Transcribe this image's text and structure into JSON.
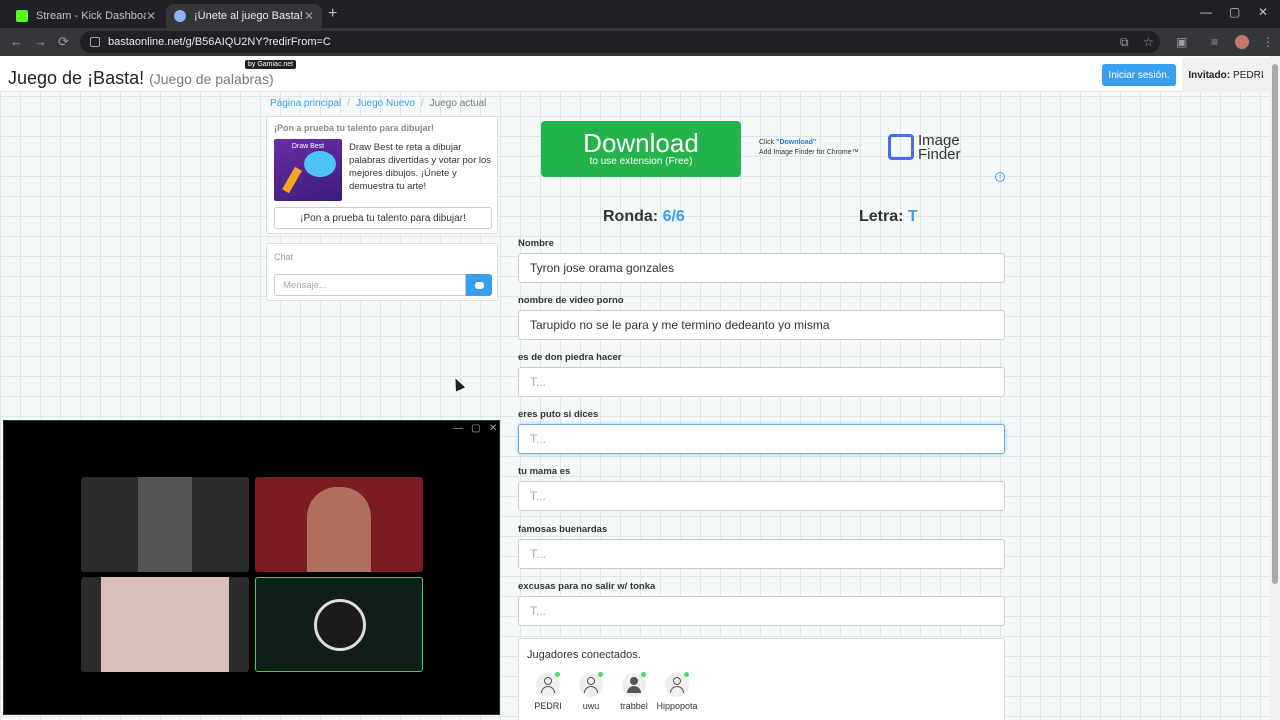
{
  "browser": {
    "tabs": [
      {
        "title": "Stream - Kick Dashboard",
        "close": "✕"
      },
      {
        "title": "¡Únete al juego Basta!",
        "close": "✕"
      }
    ],
    "new_tab": "+",
    "window_controls": [
      "—",
      "▢",
      "✕"
    ],
    "nav": [
      "←",
      "→",
      "⟳"
    ],
    "url": "bastaonline.net/g/B56AIQU2NY?redirFrom=C",
    "toolbar_icons": [
      "translate-icon",
      "star-icon",
      "screen-icon",
      "media-icon",
      "profile-icon",
      "menu-icon"
    ],
    "toolbar_glyphs": [
      "⧉",
      "☆",
      "▣",
      "≡",
      "⋮"
    ]
  },
  "header": {
    "title": "Juego de ¡Basta!",
    "subtitle": "(Juego de palabras)",
    "badge": "by Gamiac.net",
    "login": "Iniciar sesión.",
    "guest_label": "Invitado:",
    "guest_name": "PEDRI"
  },
  "breadcrumb": {
    "home": "Página principal",
    "sep": "/",
    "new_game": "Juego Nuevo",
    "current": "Juego actual"
  },
  "promo": {
    "title": "¡Pon a prueba tu talento para dibujar!",
    "img_label": "Draw Best",
    "text": "Draw Best te reta a dibujar palabras divertidas y votar por los mejores dibujos. ¡Únete y demuestra tu arte!",
    "button": "¡Pon a prueba tu talento para dibujar!"
  },
  "chat": {
    "title": "Chat",
    "placeholder": "Mensaje..."
  },
  "ad": {
    "download": "Download",
    "sub": "to use extension (Free)",
    "click_prefix": "Click ",
    "click_hl": "\"Download\"",
    "add_text": "Add Image Finder for Chrome™",
    "brand_line1": "Image",
    "brand_line2": "Finder",
    "info": "i"
  },
  "game": {
    "round_label": "Ronda:",
    "round_value": "6/6",
    "letter_label": "Letra:",
    "letter_value": "T"
  },
  "fields": [
    {
      "label": "Nombre",
      "value": "Tyron jose orama gonzales"
    },
    {
      "label": "nombre de video porno",
      "value": "Tarupido no se le para y me termino dedeanto yo misma"
    },
    {
      "label": "es de don piedra hacer",
      "value": "T..."
    },
    {
      "label": "eres puto si dices",
      "value": "T..."
    },
    {
      "label": "tu mama es",
      "value": "T..."
    },
    {
      "label": "famosas buenardas",
      "value": "T..."
    },
    {
      "label": "excusas para no salir w/ tonka",
      "value": "T..."
    }
  ],
  "players": {
    "title": "Jugadores conectados.",
    "list": [
      "PEDRI",
      "uwu",
      "trabbel",
      "Hippopota"
    ]
  },
  "call_window": {
    "controls": [
      "—",
      "▢",
      "✕"
    ]
  },
  "colors": {
    "accent": "#3a9ef0",
    "download_green": "#24b24b",
    "online": "#4cd964"
  }
}
